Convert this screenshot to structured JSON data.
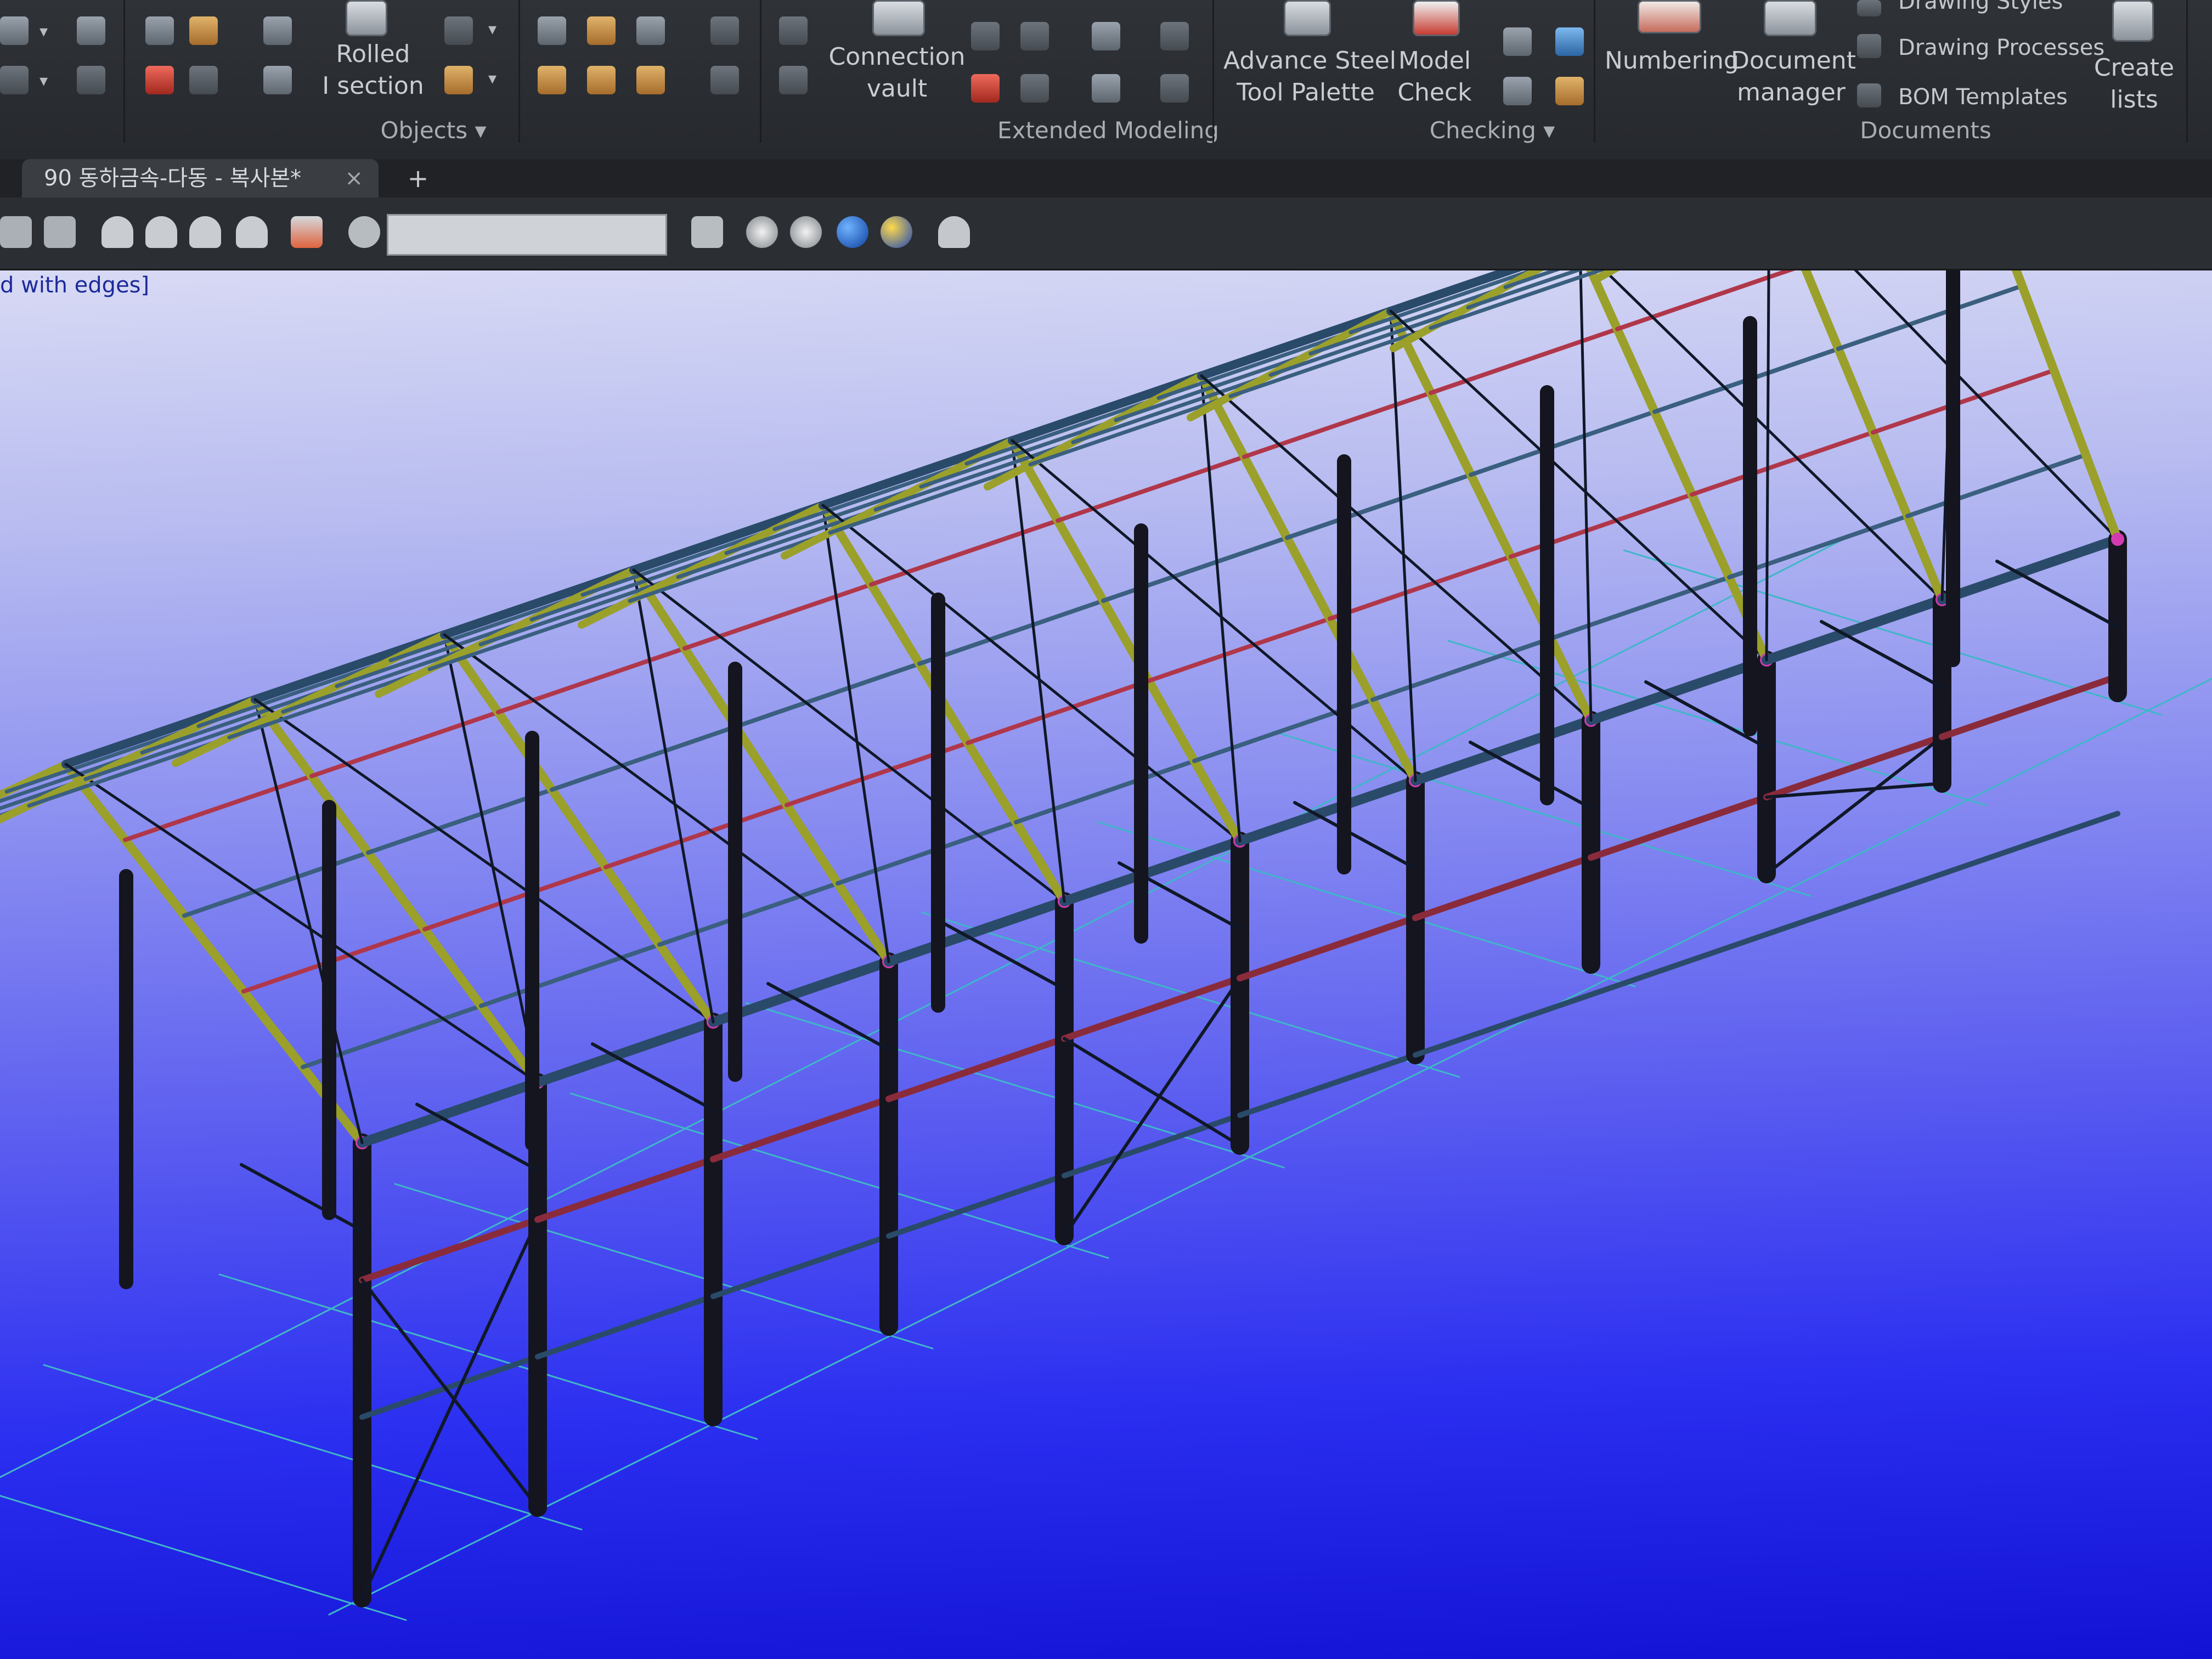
{
  "ribbon": {
    "objects_group": {
      "rolled_section_label": "Rolled\nI section",
      "group_label": "Objects"
    },
    "extended_modeling_group": {
      "connection_vault_label": "Connection\nvault",
      "group_label": "Extended Modeling"
    },
    "checking_group": {
      "advance_steel_tool_palette_label": "Advance Steel\nTool Palette",
      "model_check_label": "Model\nCheck",
      "group_label": "Checking"
    },
    "documents_group": {
      "numbering_label": "Numbering",
      "document_manager_label": "Document\nmanager",
      "drawing_styles_label": "Drawing Styles",
      "drawing_processes_label": "Drawing Processes",
      "bom_templates_label": "BOM Templates",
      "create_lists_label": "Create\nlists",
      "group_label": "Documents"
    }
  },
  "document_tab": {
    "label": "90 동하금속-다동 - 복사본*",
    "close": "×",
    "new_tab": "+"
  },
  "viewport": {
    "visual_style_label": "d with edges]"
  },
  "colors": {
    "ribbon_bg": "#2b2e32",
    "viewport_bg_top": "#d8daf4",
    "viewport_bg_bottom": "#1212d4",
    "column_color": "#15151f",
    "beam_color": "#2a4a6a",
    "rafter_color": "#9aa02a",
    "bracing_color": "#101828",
    "grid_color": "#3fb6c8"
  }
}
